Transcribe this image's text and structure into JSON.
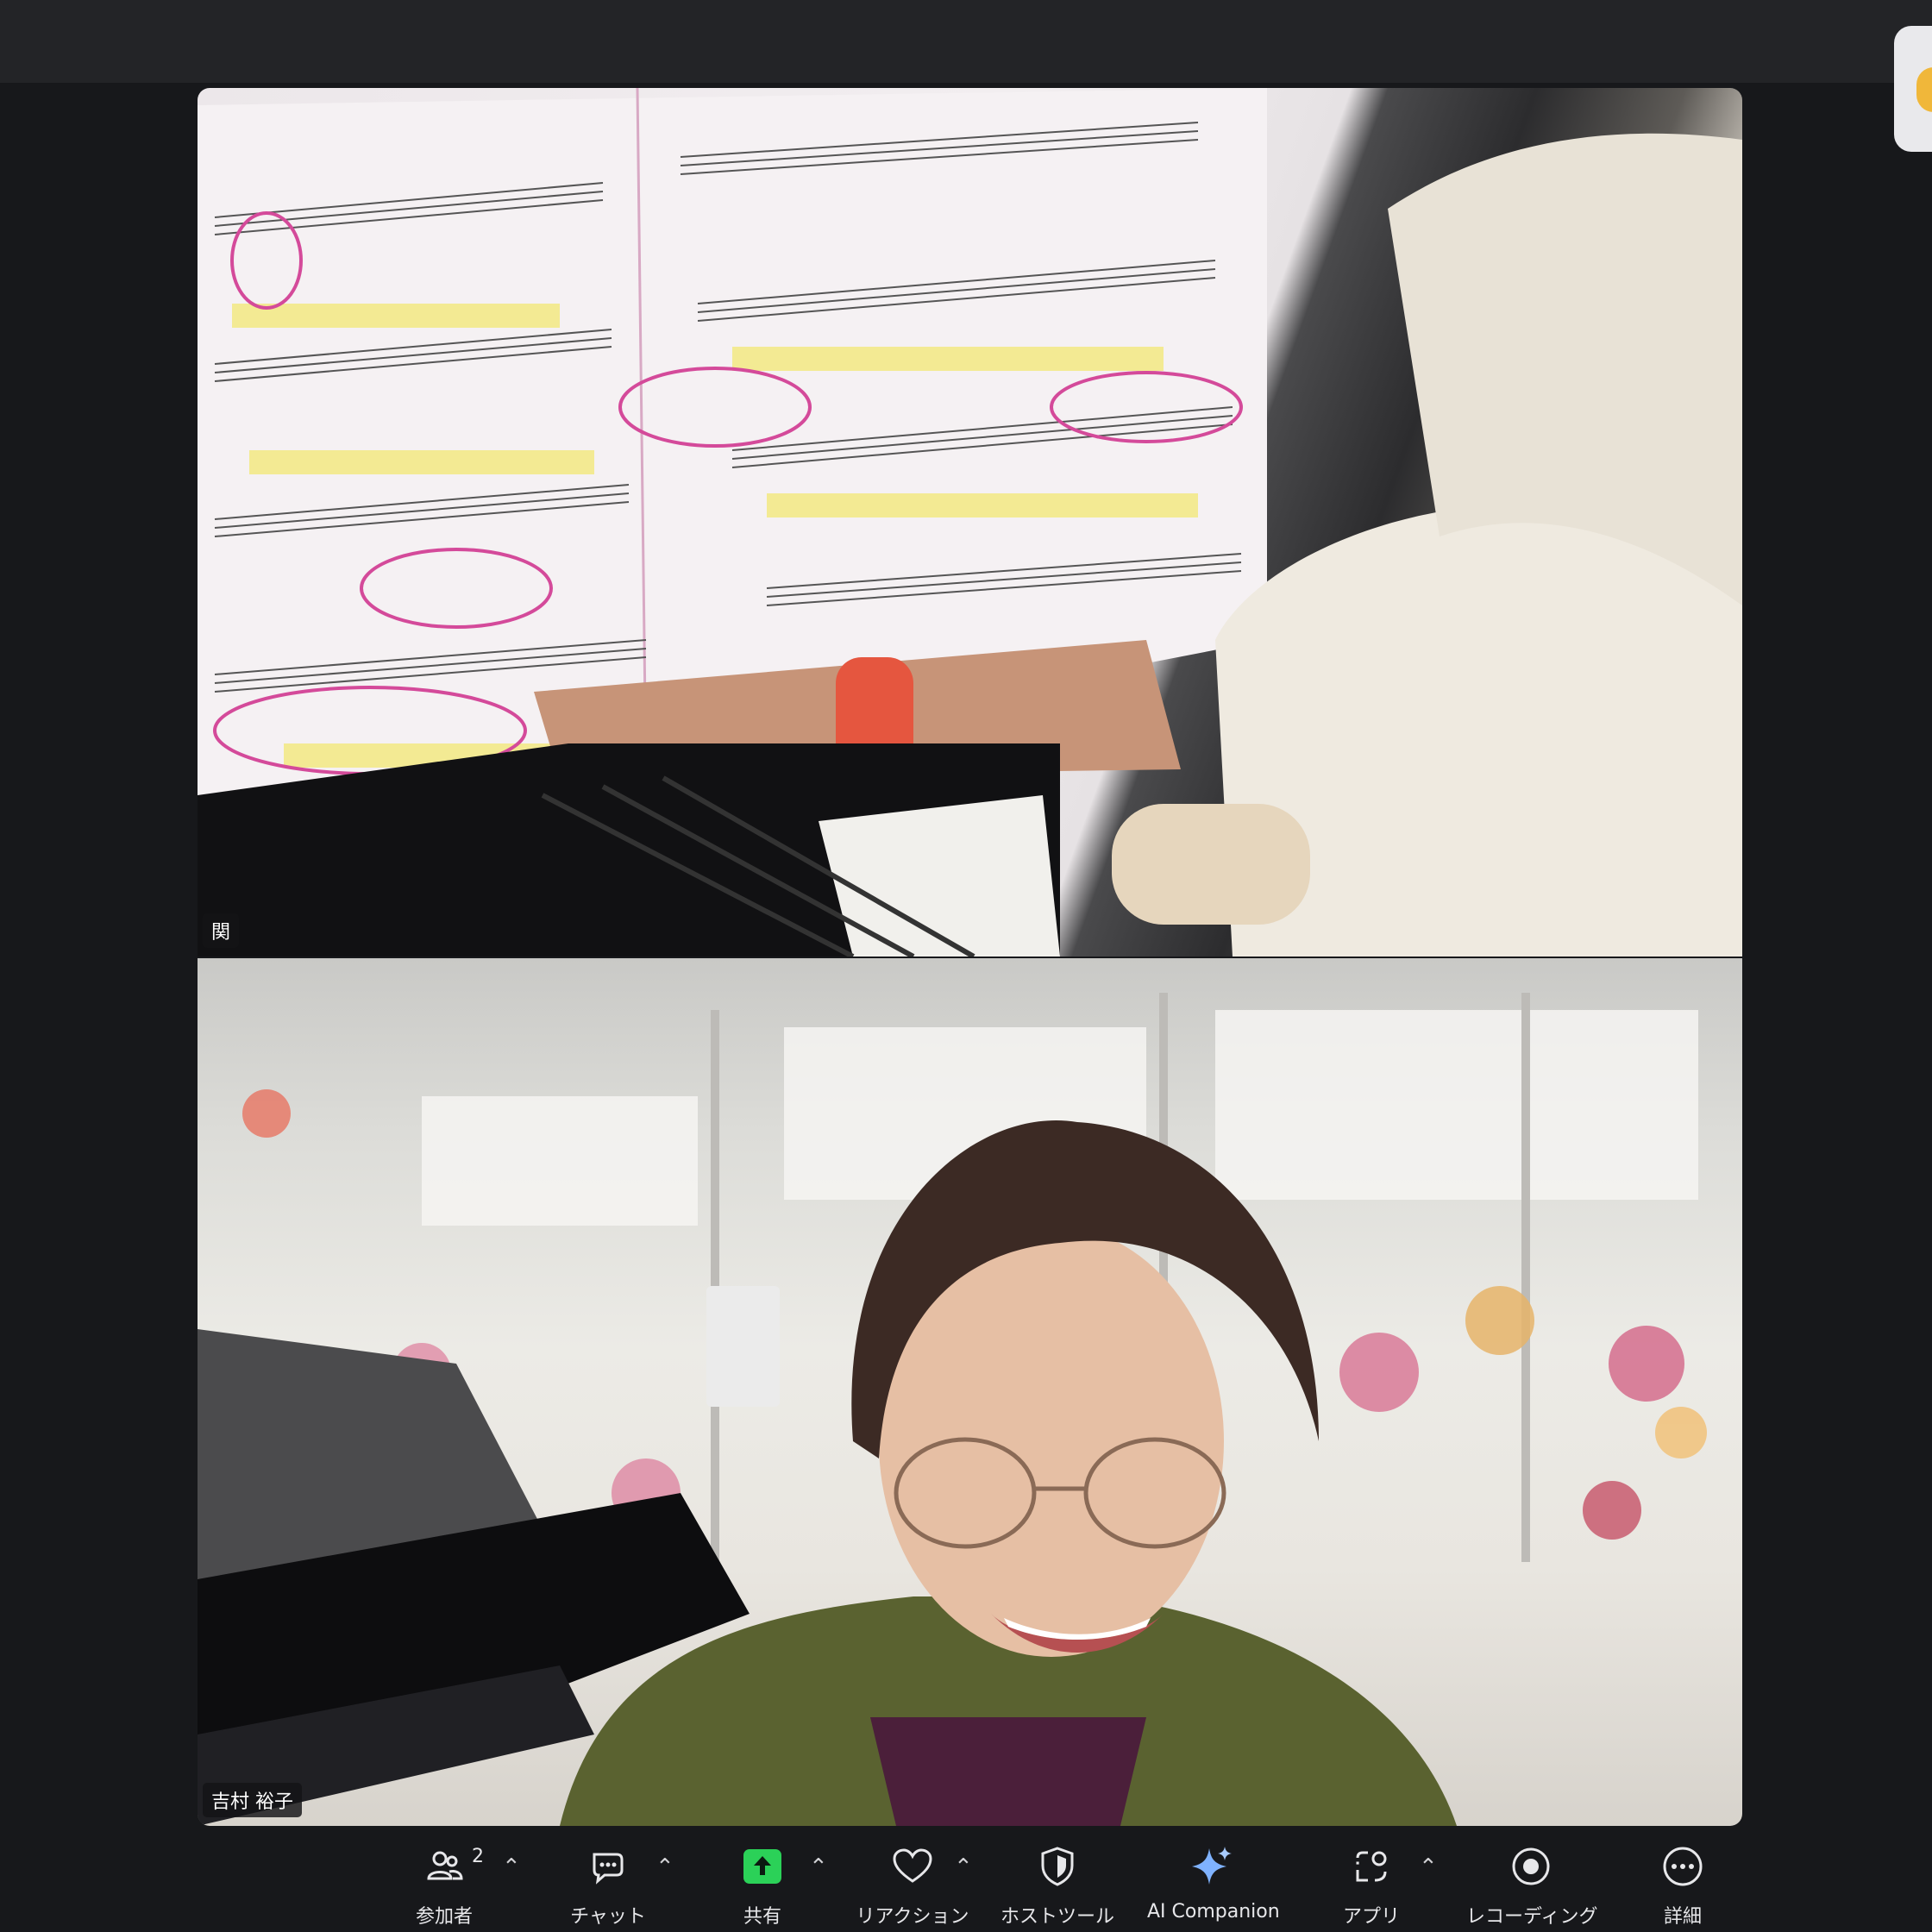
{
  "participants": [
    {
      "name": "関"
    },
    {
      "name": "吉村 裕子"
    }
  ],
  "toolbar": {
    "participants_label": "参加者",
    "participants_count": "2",
    "chat_label": "チャット",
    "share_label": "共有",
    "reaction_label": "リアクション",
    "host_tools_label": "ホストツール",
    "ai_companion_label": "AI Companion",
    "apps_label": "アプリ",
    "recording_label": "レコーディング",
    "more_label": "詳細"
  },
  "colors": {
    "background": "#17181b",
    "share_accent": "#2bd158",
    "ai_accent": "#7fb2ff"
  }
}
